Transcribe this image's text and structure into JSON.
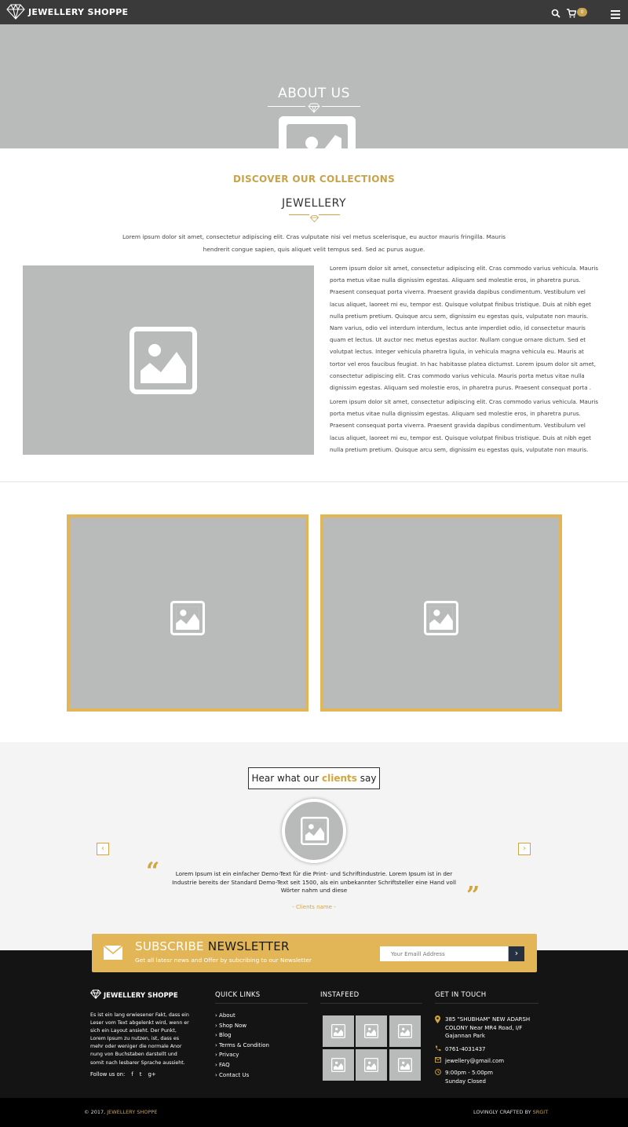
{
  "header": {
    "brand": "JEWELLERY SHOPPE",
    "cart_count": "0"
  },
  "hero": {
    "title": "ABOUT US"
  },
  "discover": {
    "heading": "DISCOVER OUR COLLECTIONS",
    "subheading": "JEWELLERY",
    "intro": "Lorem ipsum dolor sit amet, consectetur adipiscing elit. Cras vulputate nisi vel metus scelerisque, eu auctor mauris fringilla. Mauris hendrerit congue sapien, quis aliquet velit tempus sed. Sed ac purus augue.",
    "para1": "Lorem ipsum dolor sit amet, consectetur adipiscing elit. Cras commodo varius vehicula. Mauris porta metus vitae nulla dignissim egestas. Aliquam sed molestie eros, in pharetra purus. Praesent consequat porta viverra. Praesent gravida dapibus condimentum. Vestibulum vel lacus aliquet, laoreet mi eu, tempor est. Quisque volutpat finibus tristique. Duis at nibh eget nulla pretium pretium. Quisque arcu sem, dignissim eu egestas quis, vulputate non mauris. Nam varius, odio vel interdum interdum, lectus ante imperdiet odio, id consectetur mauris quam et lectus. Ut auctor nec metus egestas auctor. Nullam congue ornare dictum. Sed et volutpat lectus. Integer vehicula pharetra ligula, in vehicula magna vehicula eu. Mauris at tortor vel eros faucibus feugiat. In hac habitasse platea dictumst. Lorem ipsum dolor sit amet, consectetur adipiscing elit. Cras commodo varius vehicula. Mauris porta metus vitae nulla dignissim egestas. Aliquam sed molestie eros, in pharetra purus. Praesent consequat porta .",
    "para2": "Lorem ipsum dolor sit amet, consectetur adipiscing elit. Cras commodo varius vehicula. Mauris porta metus vitae nulla dignissim egestas. Aliquam sed molestie eros, in pharetra purus. Praesent consequat porta viverra. Praesent gravida dapibus condimentum. Vestibulum vel lacus aliquet, laoreet mi eu, tempor est. Quisque volutpat finibus tristique. Duis at nibh eget nulla pretium pretium. Quisque arcu sem, dignissim eu egestas quis, vulputate non mauris."
  },
  "testimonials": {
    "title_pre": "Hear what our",
    "title_accent": "clients",
    "title_post": "say",
    "prev": "‹",
    "next": "›",
    "quote": "Lorem Ipsum ist ein einfacher Demo-Text für die Print- und Schriftindustrie. Lorem Ipsum ist in der Industrie bereits der Standard Demo-Text seit 1500, als ein unbekannter Schriftsteller eine Hand voll Wörter nahm und diese",
    "client_name": "- Clients name -"
  },
  "newsletter": {
    "title_a": "SUBSCRIBE",
    "title_b": "NEWSLETTER",
    "subtitle": "Get all latesr news and Offer by subcribing to our Newsletter",
    "placeholder": "Your Emaill Address",
    "submit": "›"
  },
  "footer": {
    "brand": "JEWELLERY SHOPPE",
    "about": "Es ist ein lang erwiesener Fakt, dass ein Leser vom Text abgelenkt wird, wenn er sich ein Layout ansieht. Der Punkt, Lorem Ipsum zu nutzen, ist, dass es mehr oder weniger die normale Anor nung von Buchstaben darstellt und somit nach lesbarer Sprache aussieht.",
    "follow": "Follow us on:",
    "social": [
      "f",
      "t",
      "g+"
    ],
    "quick_links_heading": "QUICK LINKS",
    "quick_links": [
      "› About",
      "› Shop Now",
      "› Blog",
      "› Terms & Condition",
      "› Privacy",
      "› FAQ",
      "› Contact Us"
    ],
    "instafeed_heading": "INSTAFEED",
    "contact_heading": "GET IN TOUCH",
    "address_1": "385 \"SHUBHAM\" NEW ADARSH",
    "address_2": "COLONY Near MR4 Road, I/F",
    "address_3": "Gajannan Park",
    "phone": "0761-4031437",
    "email": "jewellery@gmail.com",
    "hours_1": "9:00pm - 5:00pm",
    "hours_2": "Sunday Closed"
  },
  "copyright": {
    "left_pre": "© 2017,",
    "left_brand": "JEWELLERY SHOPPE",
    "right_pre": "LOVINGLY CRAFTED BY",
    "right_brand": "SRGIT"
  },
  "colors": {
    "accent": "#e2b657",
    "accent_text": "#d2a53f",
    "header_bg": "#3a3a3a",
    "placeholder_gray": "#b9baba",
    "footer_bg": "#141414"
  }
}
